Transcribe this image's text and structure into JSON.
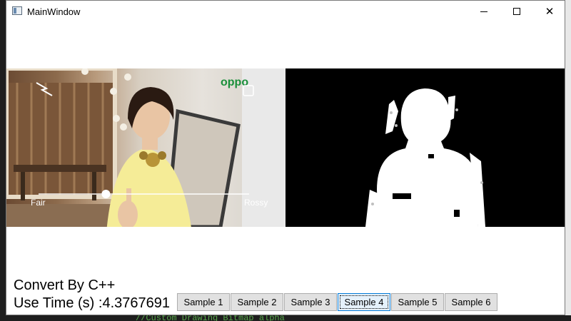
{
  "window": {
    "title": "MainWindow"
  },
  "window_controls": {
    "minimize": "minimize",
    "maximize": "maximize",
    "close": "✕"
  },
  "left_image": {
    "brand": "oppo",
    "slider_left_label": "Fair",
    "slider_right_label": "Rossy",
    "slider_level": 0.32
  },
  "status": {
    "convert_text": "Convert By C++",
    "time_text": "Use Time (s) :4.3767691"
  },
  "samples": [
    {
      "label": "Sample 1",
      "active": false
    },
    {
      "label": "Sample 2",
      "active": false
    },
    {
      "label": "Sample 3",
      "active": false
    },
    {
      "label": "Sample 4",
      "active": true
    },
    {
      "label": "Sample 5",
      "active": false
    },
    {
      "label": "Sample 6",
      "active": false
    }
  ],
  "background": {
    "code_snippet": "//Custom Drawing Bitmap alpha"
  }
}
